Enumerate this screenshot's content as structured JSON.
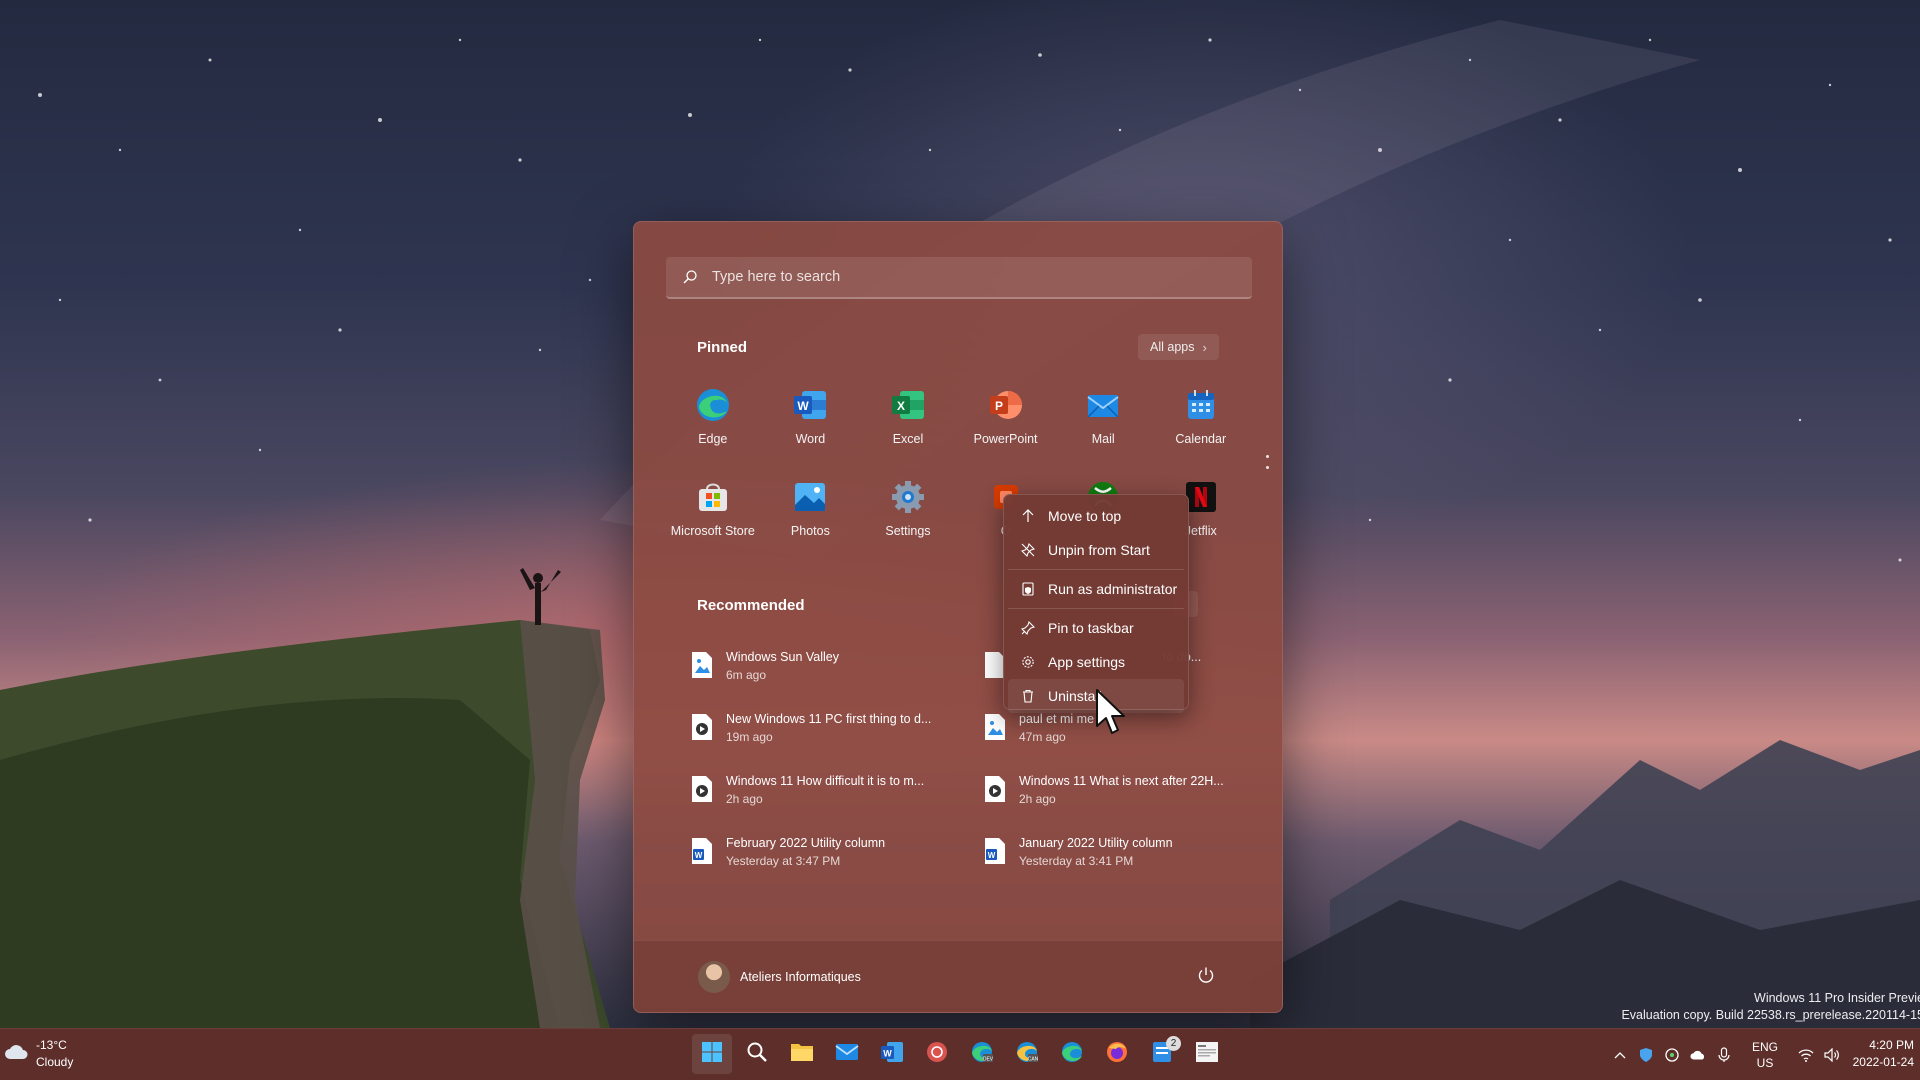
{
  "start": {
    "search_placeholder": "Type here to search",
    "pinned_title": "Pinned",
    "all_apps_label": "All apps",
    "pinned_apps": [
      {
        "label": "Edge",
        "icon": "edge-icon"
      },
      {
        "label": "Word",
        "icon": "word-icon"
      },
      {
        "label": "Excel",
        "icon": "excel-icon"
      },
      {
        "label": "PowerPoint",
        "icon": "powerpoint-icon"
      },
      {
        "label": "Mail",
        "icon": "mail-icon"
      },
      {
        "label": "Calendar",
        "icon": "calendar-icon"
      },
      {
        "label": "Microsoft Store",
        "icon": "store-icon"
      },
      {
        "label": "Photos",
        "icon": "photos-icon"
      },
      {
        "label": "Settings",
        "icon": "settings-icon"
      },
      {
        "label": "O",
        "icon": "office-icon"
      },
      {
        "label": "",
        "icon": "xbox-icon"
      },
      {
        "label": "Jetflix",
        "icon": "netflix-icon"
      }
    ],
    "recommended_title": "Recommended",
    "recommended": [
      {
        "name": "Windows Sun Valley",
        "time": "6m ago",
        "icon": "image-file-icon"
      },
      {
        "name": "to do...",
        "time": "",
        "icon": "document-file-icon"
      },
      {
        "name": "New Windows 11 PC first thing to d...",
        "time": "19m ago",
        "icon": "video-file-icon"
      },
      {
        "name": "paul et mi         me",
        "time": "47m ago",
        "icon": "image-file-icon"
      },
      {
        "name": "Windows 11 How difficult it is to m...",
        "time": "2h ago",
        "icon": "video-file-icon"
      },
      {
        "name": "Windows 11 What is next after 22H...",
        "time": "2h ago",
        "icon": "video-file-icon"
      },
      {
        "name": "February 2022 Utility column",
        "time": "Yesterday at 3:47 PM",
        "icon": "word-file-icon"
      },
      {
        "name": "January 2022 Utility column",
        "time": "Yesterday at 3:41 PM",
        "icon": "word-file-icon"
      }
    ],
    "user_name": "Ateliers Informatiques"
  },
  "context_menu": {
    "items": [
      {
        "label": "Move to top",
        "icon": "arrow-up-icon"
      },
      {
        "label": "Unpin from Start",
        "icon": "unpin-icon"
      },
      {
        "label": "Run as administrator",
        "icon": "shield-icon"
      },
      {
        "label": "Pin to taskbar",
        "icon": "pin-icon"
      },
      {
        "label": "App settings",
        "icon": "gear-icon"
      },
      {
        "label": "Uninstall",
        "icon": "trash-icon"
      }
    ]
  },
  "watermark": {
    "line1": "Windows 11 Pro Insider Previe",
    "line2": "Evaluation copy. Build 22538.rs_prerelease.220114-15"
  },
  "taskbar": {
    "temperature": "-13°C",
    "condition": "Cloudy",
    "notification_count": "2",
    "lang_line1": "ENG",
    "lang_line2": "US",
    "time": "4:20 PM",
    "date": "2022-01-24"
  },
  "colors": {
    "start_bg": "#8C4A42",
    "taskbar_bg": "#60302A",
    "accent": "#2F8FE6"
  }
}
